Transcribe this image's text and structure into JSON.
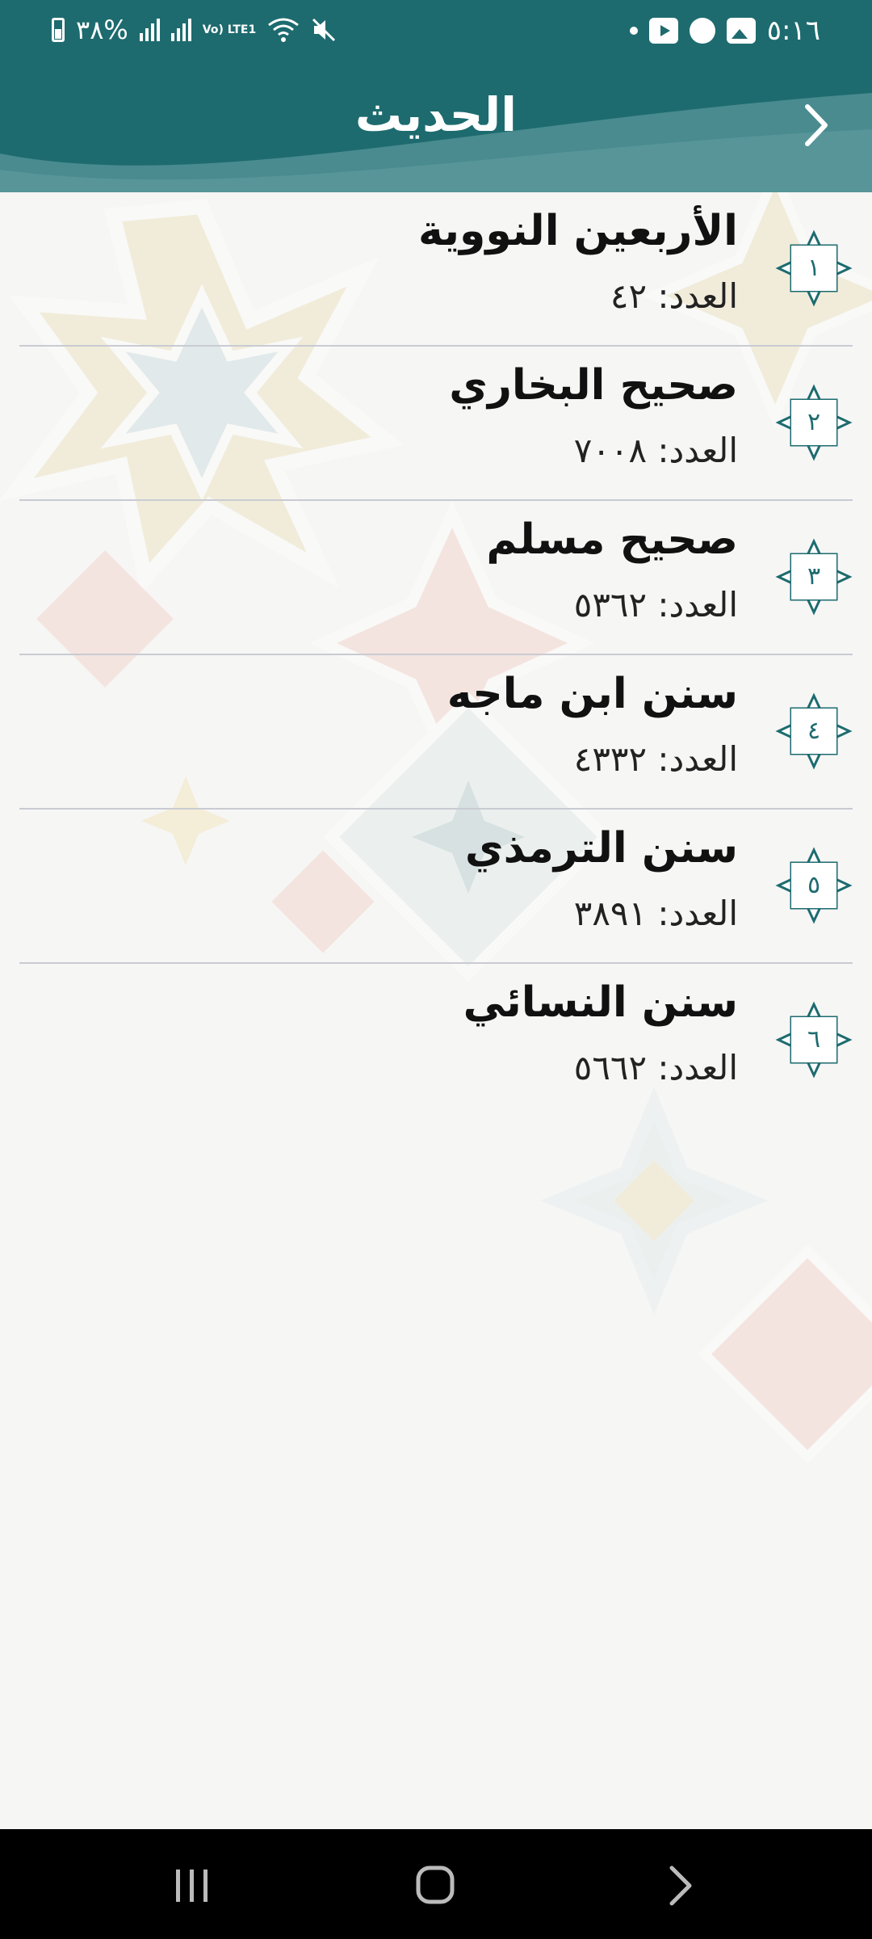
{
  "status_bar": {
    "time": "٥:١٦",
    "battery": "٣٨%",
    "network": "Vo) LTE1",
    "icons": [
      "battery-icon",
      "signal-icon",
      "signal-icon",
      "wifi-icon",
      "mute-icon",
      "dot-icon",
      "youtube-icon",
      "football-icon",
      "gallery-icon"
    ]
  },
  "header": {
    "title": "الحديث",
    "back_icon": "chevron-right-icon"
  },
  "count_label": "العدد:",
  "books": [
    {
      "index": "١",
      "name": "الأربعين النووية",
      "count": "العدد: ٤٢"
    },
    {
      "index": "٢",
      "name": "صحيح البخاري",
      "count": "العدد: ٧٠٠٨"
    },
    {
      "index": "٣",
      "name": "صحيح مسلم",
      "count": "العدد: ٥٣٦٢"
    },
    {
      "index": "٤",
      "name": "سنن ابن ماجه",
      "count": "العدد: ٤٣٣٢"
    },
    {
      "index": "٥",
      "name": "سنن الترمذي",
      "count": "العدد: ٣٨٩١"
    },
    {
      "index": "٦",
      "name": "سنن النسائي",
      "count": "العدد: ٥٦٦٢"
    }
  ],
  "nav_bar": {
    "recent_icon": "recent-apps-icon",
    "home_icon": "home-icon",
    "back_icon": "back-icon"
  },
  "colors": {
    "primary": "#1d6b6f",
    "background": "#f6f6f5",
    "separator": "#c9cbd2",
    "nav": "#000000"
  }
}
